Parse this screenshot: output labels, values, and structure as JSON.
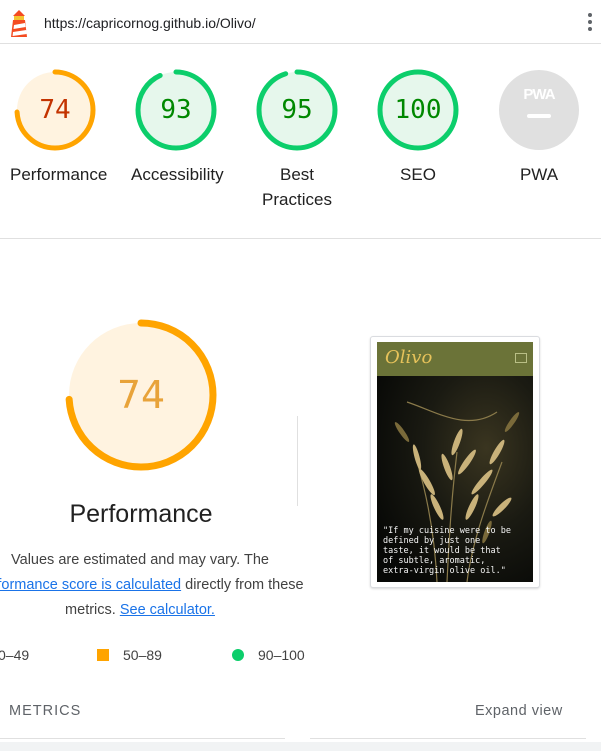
{
  "topbar": {
    "url": "https://capricornog.github.io/Olivo/"
  },
  "scores": [
    {
      "value": "74",
      "label": "Performance",
      "color": "#ffa400",
      "text_color": "#c33300",
      "fill": "#fff3e0",
      "fraction": 0.74
    },
    {
      "value": "93",
      "label": "Accessibility",
      "color": "#0cce6b",
      "text_color": "#008800",
      "fill": "#e6f7ec",
      "fraction": 0.93
    },
    {
      "value": "95",
      "label": "Best Practices",
      "color": "#0cce6b",
      "text_color": "#008800",
      "fill": "#e6f7ec",
      "fraction": 0.95
    },
    {
      "value": "100",
      "label": "SEO",
      "color": "#0cce6b",
      "text_color": "#008800",
      "fill": "#e6f7ec",
      "fraction": 1.0
    },
    {
      "label": "PWA",
      "badge_text": "PWA"
    }
  ],
  "performance": {
    "score": "74",
    "fraction": 0.74,
    "title": "Performance",
    "desc_1": "Values are estimated and may vary. The",
    "desc_link": "performance score is calculated",
    "desc_2": "directly from these metrics.",
    "desc_link2": "See calculator."
  },
  "legend": {
    "fail": "0–49",
    "average": "50–89",
    "pass": "90–100"
  },
  "metrics": {
    "label": "METRICS",
    "expand": "Expand view"
  },
  "screenshot": {
    "logo": "Olivo",
    "quote": "\"If my cuisine were to be defined by just one taste, it would be that of subtle, aromatic, extra-virgin olive oil.\""
  },
  "colors": {
    "pass": "#0cce6b",
    "average": "#ffa400",
    "fail": "#ff4e42"
  }
}
